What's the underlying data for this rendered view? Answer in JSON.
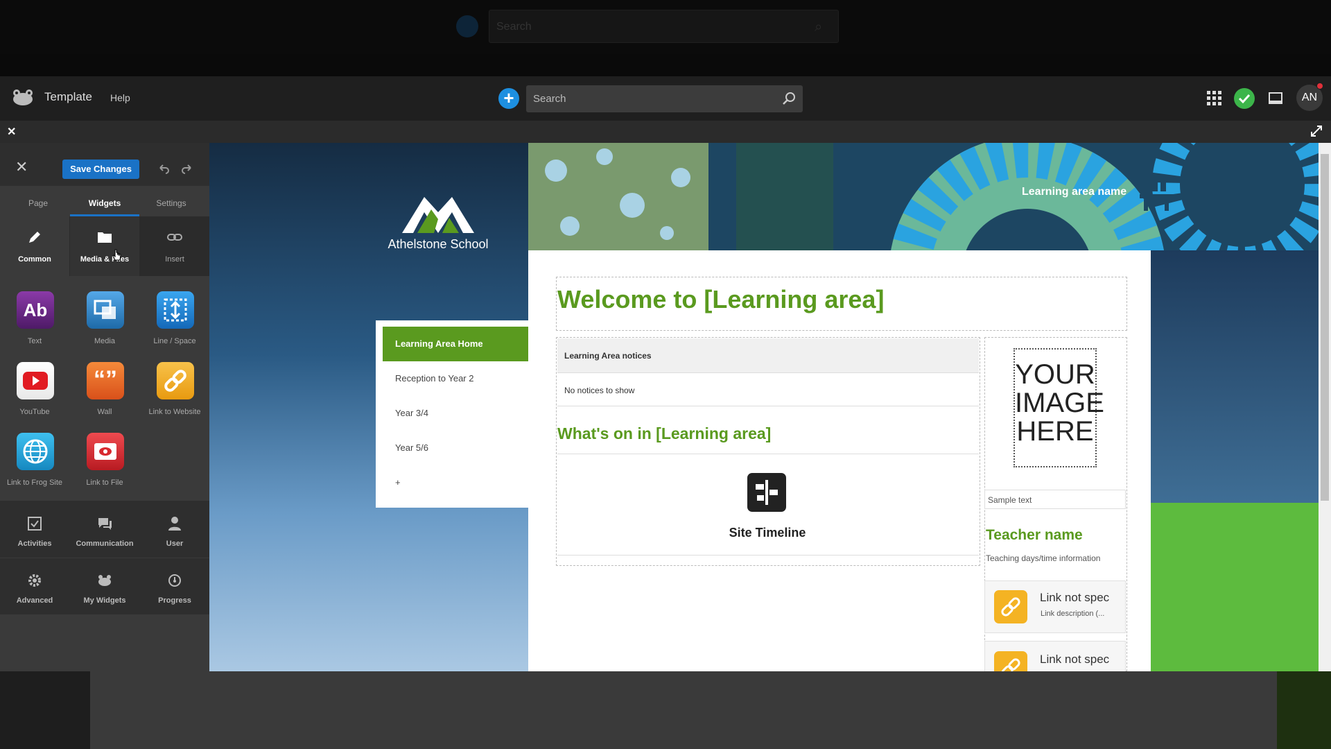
{
  "dim_header": {
    "search_placeholder": "Search"
  },
  "header": {
    "title": "Template",
    "help": "Help",
    "search_placeholder": "Search",
    "avatar_initials": "AN"
  },
  "panel": {
    "save_label": "Save Changes",
    "tabs": [
      "Page",
      "Widgets",
      "Settings"
    ],
    "categories": [
      "Common",
      "Media & Files",
      "Insert"
    ],
    "widgets": [
      {
        "label": "Text",
        "icon": "text-icon",
        "color": "#6d2a8a"
      },
      {
        "label": "Media",
        "icon": "media-icon",
        "color": "#2a7fc4"
      },
      {
        "label": "Line / Space",
        "icon": "line-space-icon",
        "color": "#1e88d8"
      },
      {
        "label": "YouTube",
        "icon": "youtube-icon",
        "color": "#e11b22"
      },
      {
        "label": "Wall",
        "icon": "wall-icon",
        "color": "#ec6a1e"
      },
      {
        "label": "Link to Website",
        "icon": "link-icon",
        "color": "#f2a91e"
      },
      {
        "label": "Link to Frog Site",
        "icon": "globe-icon",
        "color": "#1ca8dd"
      },
      {
        "label": "Link to File",
        "icon": "file-link-icon",
        "color": "#d8292f"
      }
    ],
    "bottom_categories": [
      "Activities",
      "Communication",
      "User",
      "Advanced",
      "My Widgets",
      "Progress"
    ]
  },
  "preview": {
    "school_name": "Athelstone School",
    "area_name": "Learning area name",
    "nav": [
      "Learning Area Home",
      "Reception to Year 2",
      "Year 3/4",
      "Year 5/6",
      "+"
    ],
    "welcome_title": "Welcome to [Learning area]",
    "notices_title": "Learning Area notices",
    "notices_empty": "No notices to show",
    "whats_on": "What's on in [Learning area]",
    "timeline_label": "Site Timeline",
    "image_placeholder": "YOUR IMAGE HERE",
    "sample_text": "Sample text",
    "teacher_name": "Teacher name",
    "teaching_info": "Teaching days/time information",
    "links": [
      {
        "title": "Link not spec",
        "desc": "Link description (..."
      },
      {
        "title": "Link not spec",
        "desc": ""
      }
    ]
  },
  "colors": {
    "accent_green": "#5a9a1f",
    "accent_blue": "#1a72c6",
    "link_orange": "#f4b323"
  }
}
